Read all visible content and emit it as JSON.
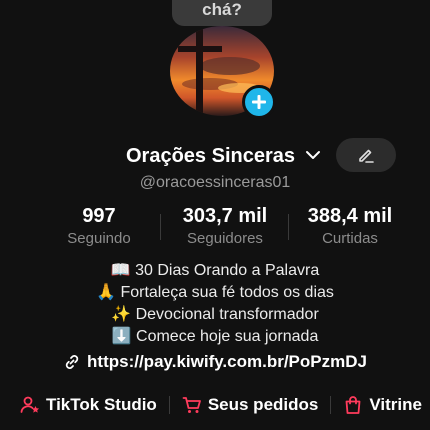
{
  "bubble": {
    "text": "chá?"
  },
  "profile": {
    "name": "Orações Sinceras",
    "handle": "@oracoessinceras01"
  },
  "stats": [
    {
      "value": "997",
      "label": "Seguindo"
    },
    {
      "value": "303,7 mil",
      "label": "Seguidores"
    },
    {
      "value": "388,4 mil",
      "label": "Curtidas"
    }
  ],
  "bio": [
    "📖 30 Dias Orando a Palavra",
    "🙏 Fortaleça sua fé todos os dias",
    "✨ Devocional transformador",
    "⬇️ Comece hoje sua jornada"
  ],
  "link": {
    "url": "https://pay.kiwify.com.br/PoPzmDJ"
  },
  "actions": [
    {
      "label": "TikTok Studio",
      "icon": "person-star-icon"
    },
    {
      "label": "Seus pedidos",
      "icon": "cart-icon"
    },
    {
      "label": "Vitrine",
      "icon": "shopping-bag-icon"
    }
  ],
  "colors": {
    "accent_red": "#ff3b5c",
    "plus_blue": "#1fb6ea",
    "background": "#111111"
  }
}
